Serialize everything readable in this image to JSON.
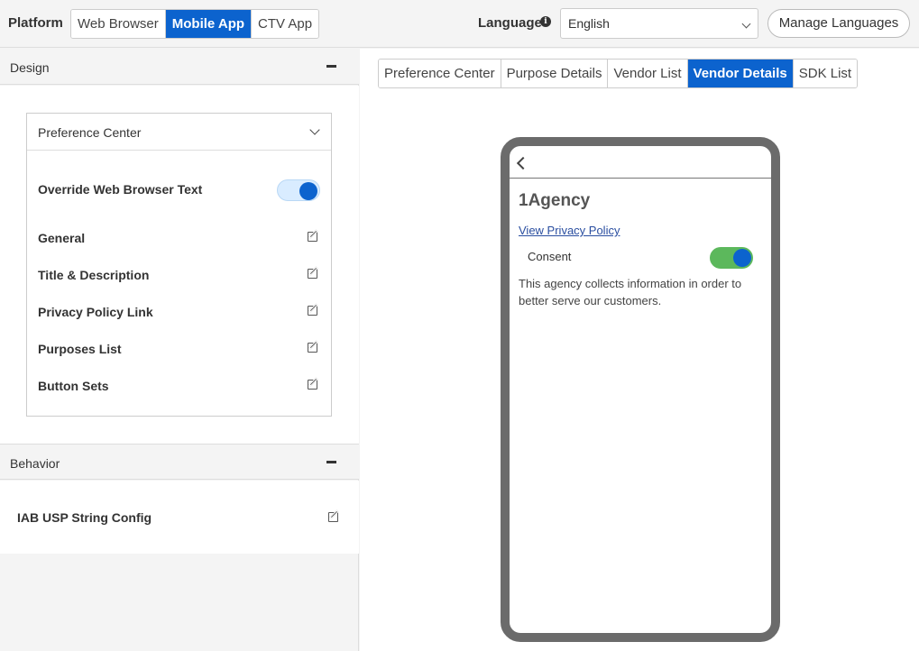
{
  "topbar": {
    "platform_label": "Platform",
    "platforms": [
      "Web Browser",
      "Mobile App",
      "CTV App"
    ],
    "active_platform": "Mobile App",
    "language_label": "Language",
    "language_value": "English",
    "manage_label": "Manage Languages"
  },
  "design": {
    "title": "Design",
    "dropdown_label": "Preference Center",
    "override_label": "Override Web Browser Text",
    "override_on": true,
    "items": [
      "General",
      "Title & Description",
      "Privacy Policy Link",
      "Purposes List",
      "Button Sets"
    ]
  },
  "behavior": {
    "title": "Behavior",
    "items": [
      "IAB USP String Config"
    ]
  },
  "preview": {
    "tabs": [
      "Preference Center",
      "Purpose Details",
      "Vendor List",
      "Vendor Details",
      "SDK List"
    ],
    "active_tab": "Vendor Details",
    "vendor_name": "1Agency",
    "privacy_link": "View Privacy Policy",
    "consent_label": "Consent",
    "consent_on": true,
    "description": "This agency collects information in order to better serve our customers."
  },
  "colors": {
    "accent": "#0c63ce",
    "toggle_green": "#5cb85c"
  }
}
